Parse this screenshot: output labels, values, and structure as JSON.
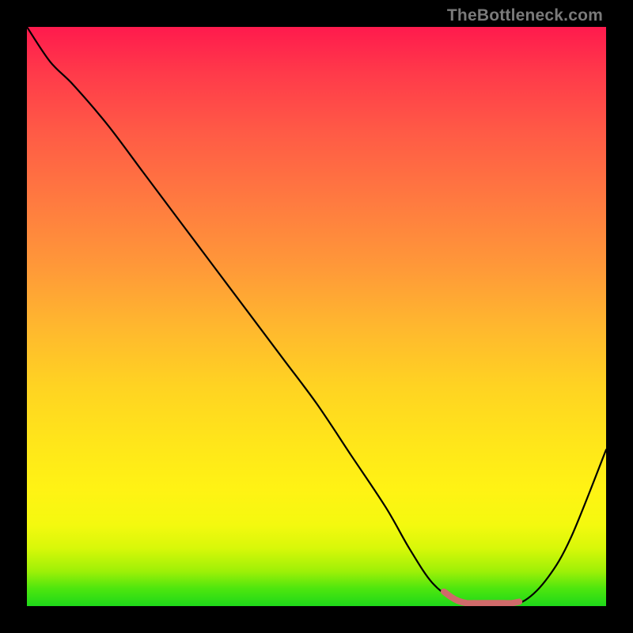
{
  "watermark": "TheBottleneck.com",
  "colors": {
    "frame": "#000000",
    "curve": "#000000",
    "highlight": "#d06a6a",
    "gradient_stops": [
      "#ff1a4d",
      "#ff5a46",
      "#ff9a38",
      "#ffd322",
      "#fff314",
      "#d8f809",
      "#4de60e",
      "#1ed81a"
    ]
  },
  "chart_data": {
    "type": "line",
    "title": "",
    "xlabel": "",
    "ylabel": "",
    "xlim": [
      0,
      100
    ],
    "ylim": [
      0,
      100
    ],
    "grid": false,
    "series": [
      {
        "name": "bottleneck-curve",
        "x": [
          0,
          4,
          8,
          14,
          20,
          26,
          32,
          38,
          44,
          50,
          56,
          62,
          66,
          70,
          74,
          78,
          82,
          86,
          90,
          94,
          100
        ],
        "y": [
          100,
          94,
          90,
          83,
          75,
          67,
          59,
          51,
          43,
          35,
          26,
          17,
          10,
          4,
          1,
          0,
          0,
          1,
          5,
          12,
          27
        ]
      }
    ],
    "highlight_region": {
      "x_start": 72,
      "x_end": 85,
      "y": 0.5
    }
  }
}
